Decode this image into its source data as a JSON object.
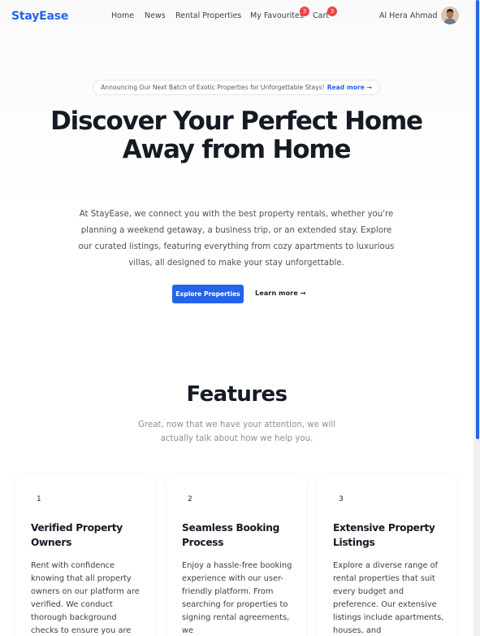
{
  "brand": {
    "logo": "StayEase",
    "accent_color": "#2563eb"
  },
  "nav": {
    "links": [
      "Home",
      "News",
      "Rental Properties",
      "My Favourites",
      "Cart"
    ],
    "favourites_count": "3",
    "cart_count": "3",
    "user_name": "Al Hera Ahmad",
    "badge_color": "#ef4444"
  },
  "hero": {
    "announcement": "Announcing Our Next Batch of Exotic Properties for Unforgettable Stays!",
    "announcement_link": "Read more →",
    "title": "Discover Your Perfect Home Away from Home",
    "description": "At StayEase, we connect you with the best property rentals, whether you're planning a weekend getaway, a business trip, or an extended stay. Explore our curated listings, featuring everything from cozy apartments to luxurious villas, all designed to make your stay unforgettable.",
    "primary_button": "Explore Properties",
    "secondary_link": "Learn more →"
  },
  "features": {
    "title": "Features",
    "subtitle": "Great, now that we have your attention, we will actually talk about how we help you.",
    "cards": [
      {
        "number": "1",
        "title": "Verified Property Owners",
        "text": "Rent with confidence knowing that all property owners on our platform are verified. We conduct thorough background checks to ensure you are"
      },
      {
        "number": "2",
        "title": "Seamless Booking Process",
        "text": "Enjoy a hassle-free booking experience with our user-friendly platform. From searching for properties to signing rental agreements, we"
      },
      {
        "number": "3",
        "title": "Extensive Property Listings",
        "text": "Explore a diverse range of rental properties that suit every budget and preference. Our extensive listings include apartments, houses, and"
      }
    ]
  }
}
